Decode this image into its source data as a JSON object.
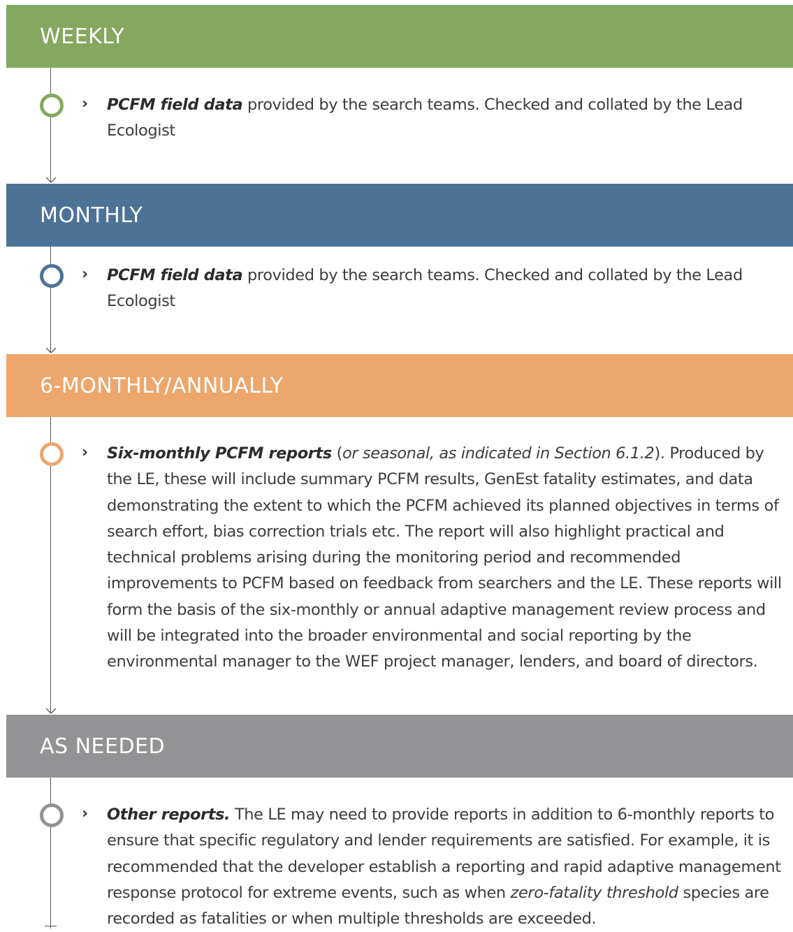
{
  "colors": {
    "weekly": "#84a85f",
    "monthly": "#4d7298",
    "six_monthly": "#eda66c",
    "as_needed": "#939396",
    "timeline_line": "#555555"
  },
  "icons": {
    "bullet": "chevron-right-icon",
    "node": "circle-node-icon",
    "arrow": "arrow-down-icon"
  },
  "sections": [
    {
      "heading": "WEEKLY",
      "bullet": "›",
      "bold": "PCFM field data",
      "text": " provided by the search teams. Checked and collated by the Lead Ecologist"
    },
    {
      "heading": "MONTHLY",
      "bullet": "›",
      "bold": "PCFM field data",
      "text": " provided by the search teams. Checked and collated by the Lead Ecologist"
    },
    {
      "heading": "6-MONTHLY/ANNUALLY",
      "bullet": "›",
      "bold": "Six-monthly PCFM reports",
      "text_a": " (",
      "italic": "or seasonal, as indicated in Section 6.1.2",
      "text_b": "). Produced by the LE, these will include summary PCFM results, GenEst fatality estimates, and data demonstrating the extent to which the PCFM achieved its planned objectives in terms of search effort, bias correction trials etc. The report will also highlight practical and technical problems arising during the monitoring period and recommended improvements to PCFM based on feedback from searchers and the LE. These reports will form the basis of the six-monthly or annual adaptive management review process and will be integrated into the broader environmental and social reporting by the environmental manager to the WEF project manager, lenders, and board of directors."
    },
    {
      "heading": "AS NEEDED",
      "bullet": "›",
      "bold": "Other reports.",
      "text_a": " The LE may need to provide reports in addition to 6-monthly reports to ensure that specific regulatory and lender requirements are satisfied. For example, it is recommended that the developer establish a reporting and rapid adaptive management response protocol for extreme events, such as when ",
      "italic": "zero-fatality threshold",
      "text_b": " species are recorded as fatalities or when multiple thresholds are exceeded."
    }
  ]
}
